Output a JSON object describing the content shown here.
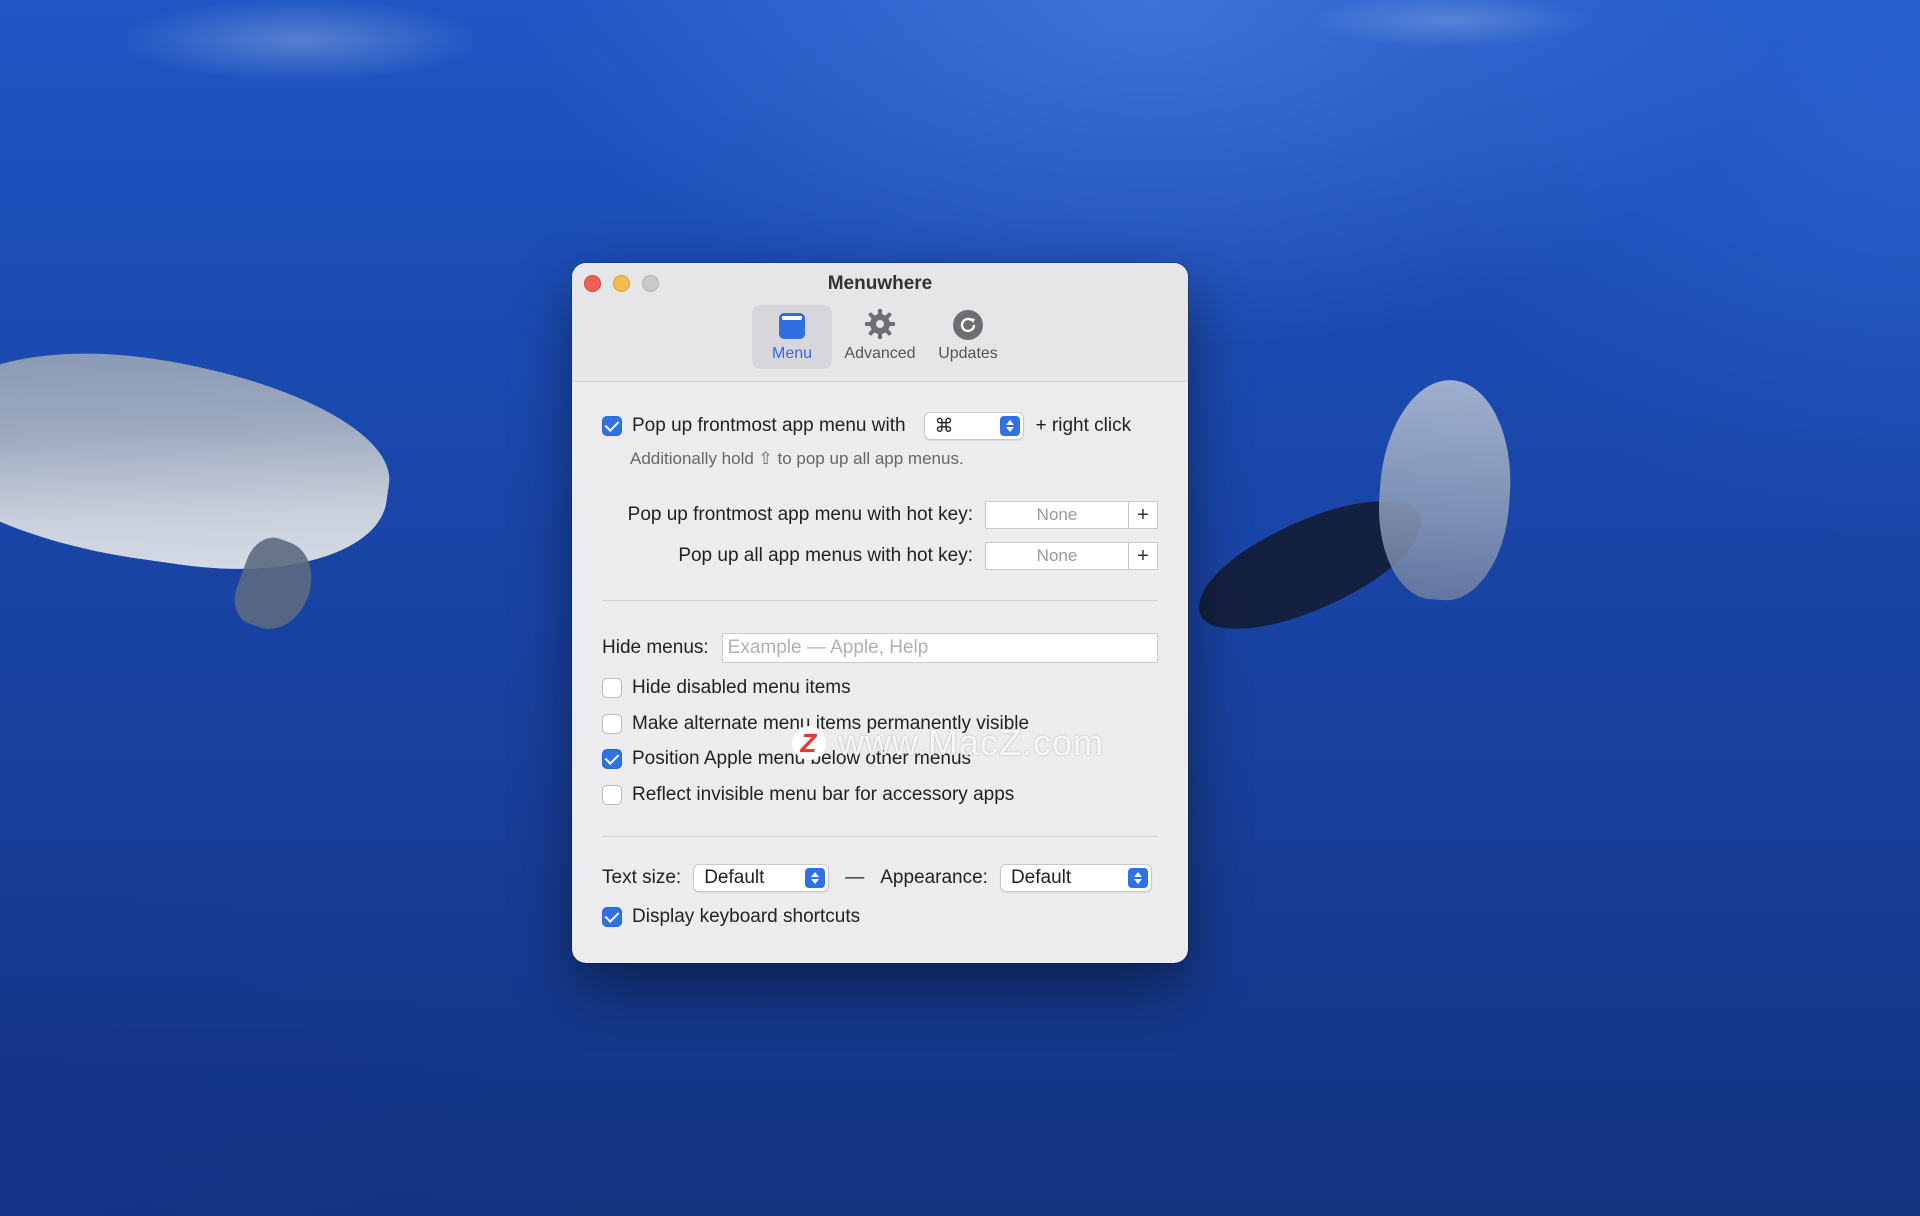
{
  "window": {
    "title": "Menuwhere"
  },
  "tabs": [
    {
      "label": "Menu",
      "active": true,
      "icon": "menu-window-icon"
    },
    {
      "label": "Advanced",
      "active": false,
      "icon": "gear-icon"
    },
    {
      "label": "Updates",
      "active": false,
      "icon": "refresh-icon"
    }
  ],
  "popup": {
    "checkbox_label": "Pop up frontmost app menu with",
    "modifier": "⌘",
    "suffix": "+ right click",
    "hint": "Additionally hold ⇧ to pop up all app menus.",
    "checked": true
  },
  "hotkeys": {
    "frontmost_label": "Pop up frontmost app menu with hot key:",
    "frontmost_value": "None",
    "all_label": "Pop up all app menus with hot key:",
    "all_value": "None",
    "plus": "+"
  },
  "watermark": {
    "logo": "Z",
    "text": "www.MacZ.com"
  },
  "hide_menus": {
    "label": "Hide menus:",
    "placeholder": "Example — Apple, Help",
    "value": ""
  },
  "options": [
    {
      "label": "Hide disabled menu items",
      "checked": false
    },
    {
      "label": "Make alternate menu items permanently visible",
      "checked": false
    },
    {
      "label": "Position Apple menu below other menus",
      "checked": true
    },
    {
      "label": "Reflect invisible menu bar for accessory apps",
      "checked": false
    }
  ],
  "display": {
    "text_size_label": "Text size:",
    "text_size_value": "Default",
    "dash": "—",
    "appearance_label": "Appearance:",
    "appearance_value": "Default",
    "shortcuts_label": "Display keyboard shortcuts",
    "shortcuts_checked": true
  },
  "colors": {
    "accent": "#2f72e6",
    "close": "#ed5f57",
    "minimize": "#f4bd4f",
    "zoom": "#c9c8cb"
  }
}
